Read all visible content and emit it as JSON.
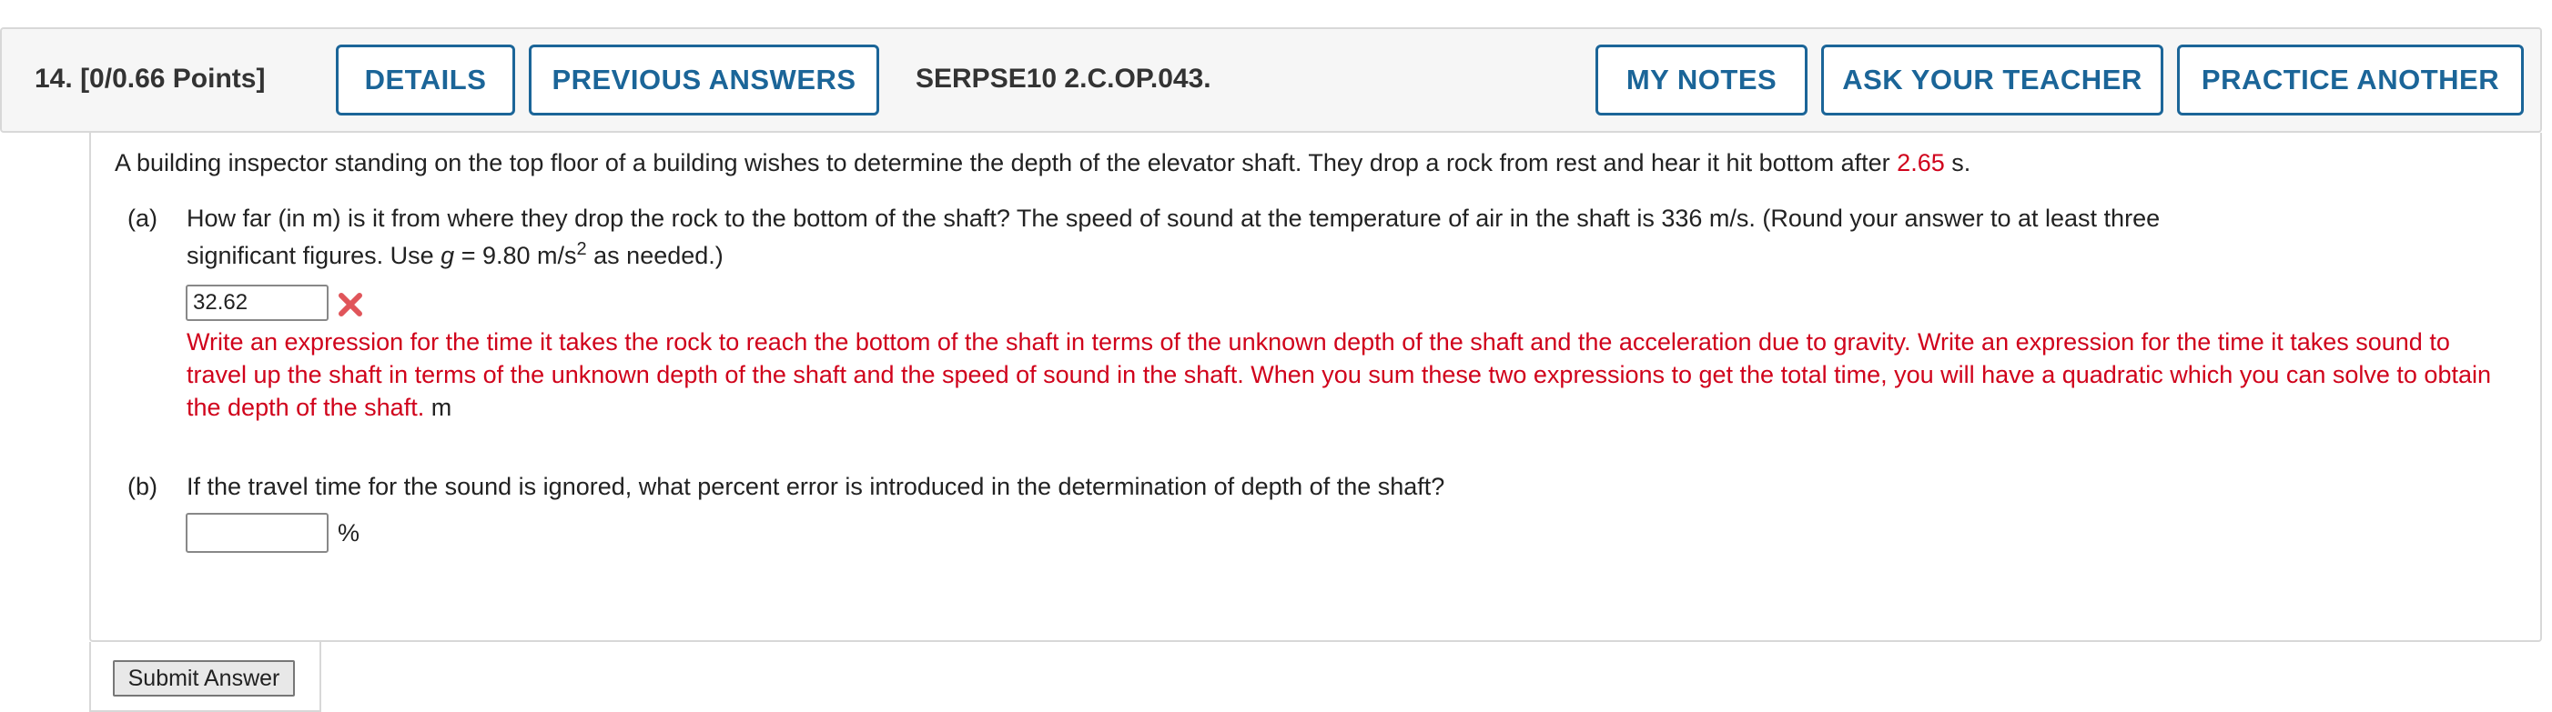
{
  "header": {
    "question_number": "14.",
    "points": "[0/0.66 Points]",
    "details_label": "DETAILS",
    "previous_answers_label": "PREVIOUS ANSWERS",
    "question_code": "SERPSE10 2.C.OP.043.",
    "my_notes_label": "MY NOTES",
    "ask_teacher_label": "ASK YOUR TEACHER",
    "practice_another_label": "PRACTICE ANOTHER"
  },
  "problem": {
    "intro": "A building inspector standing on the top floor of a building wishes to determine the depth of the elevator shaft. They drop a rock from rest and hear it hit bottom after",
    "time_value": "2.65",
    "time_unit": "s."
  },
  "part_a": {
    "label": "(a)",
    "question_line1": "How far (in m) is it from where they drop the rock to the bottom of the shaft? The speed of sound at the temperature of air in the shaft is 336 m/s. (Round your answer to at least three",
    "question_line2_prefix": "significant figures. Use",
    "g_symbol": "g",
    "g_value": "= 9.80 m/s",
    "g_exponent": "2",
    "question_line2_suffix": "as needed.)",
    "answer_value": "32.62",
    "feedback": "Write an expression for the time it takes the rock to reach the bottom of the shaft in terms of the unknown depth of the shaft and the acceleration due to gravity. Write an expression for the time it takes sound to travel up the shaft in terms of the unknown depth of the shaft and the speed of sound in the shaft. When you sum these two expressions to get the total time, you will have a quadratic which you can solve to obtain the depth of the shaft.",
    "unit": "m",
    "status_icon": "incorrect-x-icon",
    "status_color": "#e0555a"
  },
  "part_b": {
    "label": "(b)",
    "question": "If the travel time for the sound is ignored, what percent error is introduced in the determination of depth of the shaft?",
    "answer_value": "",
    "unit": "%"
  },
  "submit_label": "Submit Answer",
  "colors": {
    "accent": "#1b6598",
    "error": "#d0021b"
  }
}
